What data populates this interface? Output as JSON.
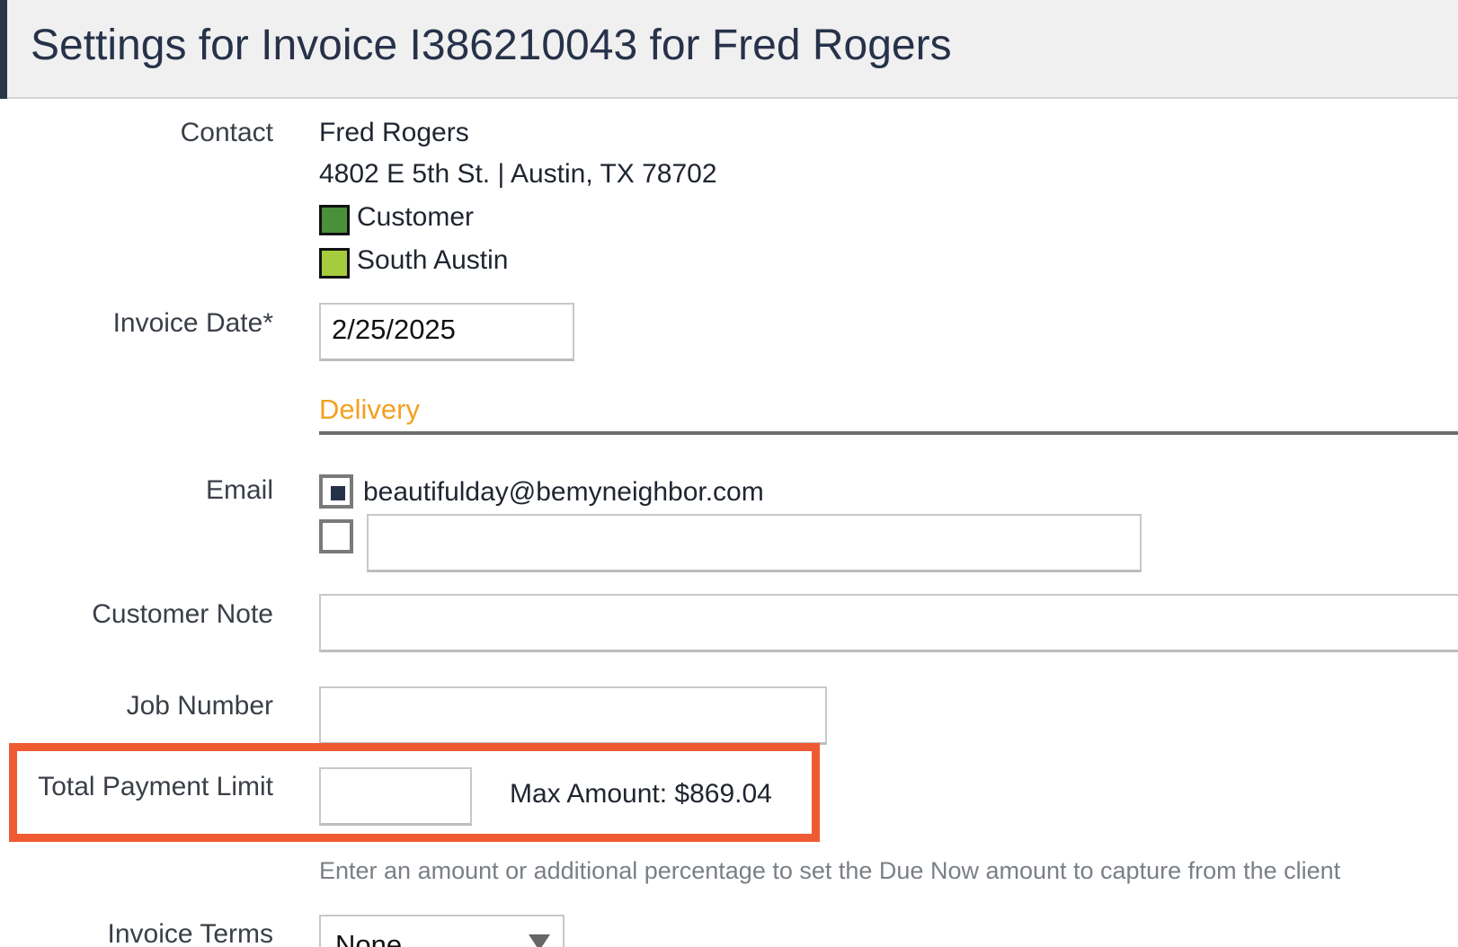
{
  "header": {
    "title": "Settings for Invoice I386210043 for Fred Rogers"
  },
  "contact": {
    "label": "Contact",
    "name": "Fred Rogers",
    "address": "4802 E 5th St. | Austin, TX 78702",
    "tags": [
      {
        "label": "Customer",
        "color": "#4a8f3a"
      },
      {
        "label": "South Austin",
        "color": "#a6cc3d"
      }
    ]
  },
  "invoice_date": {
    "label": "Invoice Date*",
    "value": "2/25/2025"
  },
  "delivery": {
    "title": "Delivery",
    "title_color": "#f4a020"
  },
  "email": {
    "label": "Email",
    "primary_address": "beautifulday@bemyneighbor.com",
    "primary_checked": true,
    "additional_value": "",
    "additional_checked": false
  },
  "customer_note": {
    "label": "Customer Note",
    "value": ""
  },
  "job_number": {
    "label": "Job Number",
    "value": ""
  },
  "payment_limit": {
    "label": "Total Payment Limit",
    "value": "",
    "max_amount": "Max Amount: $869.04",
    "highlight_color": "#ee5b33",
    "helper_text": "Enter an amount or additional percentage to set the Due Now amount to capture from the client"
  },
  "invoice_terms": {
    "label": "Invoice Terms",
    "selected": "None"
  }
}
